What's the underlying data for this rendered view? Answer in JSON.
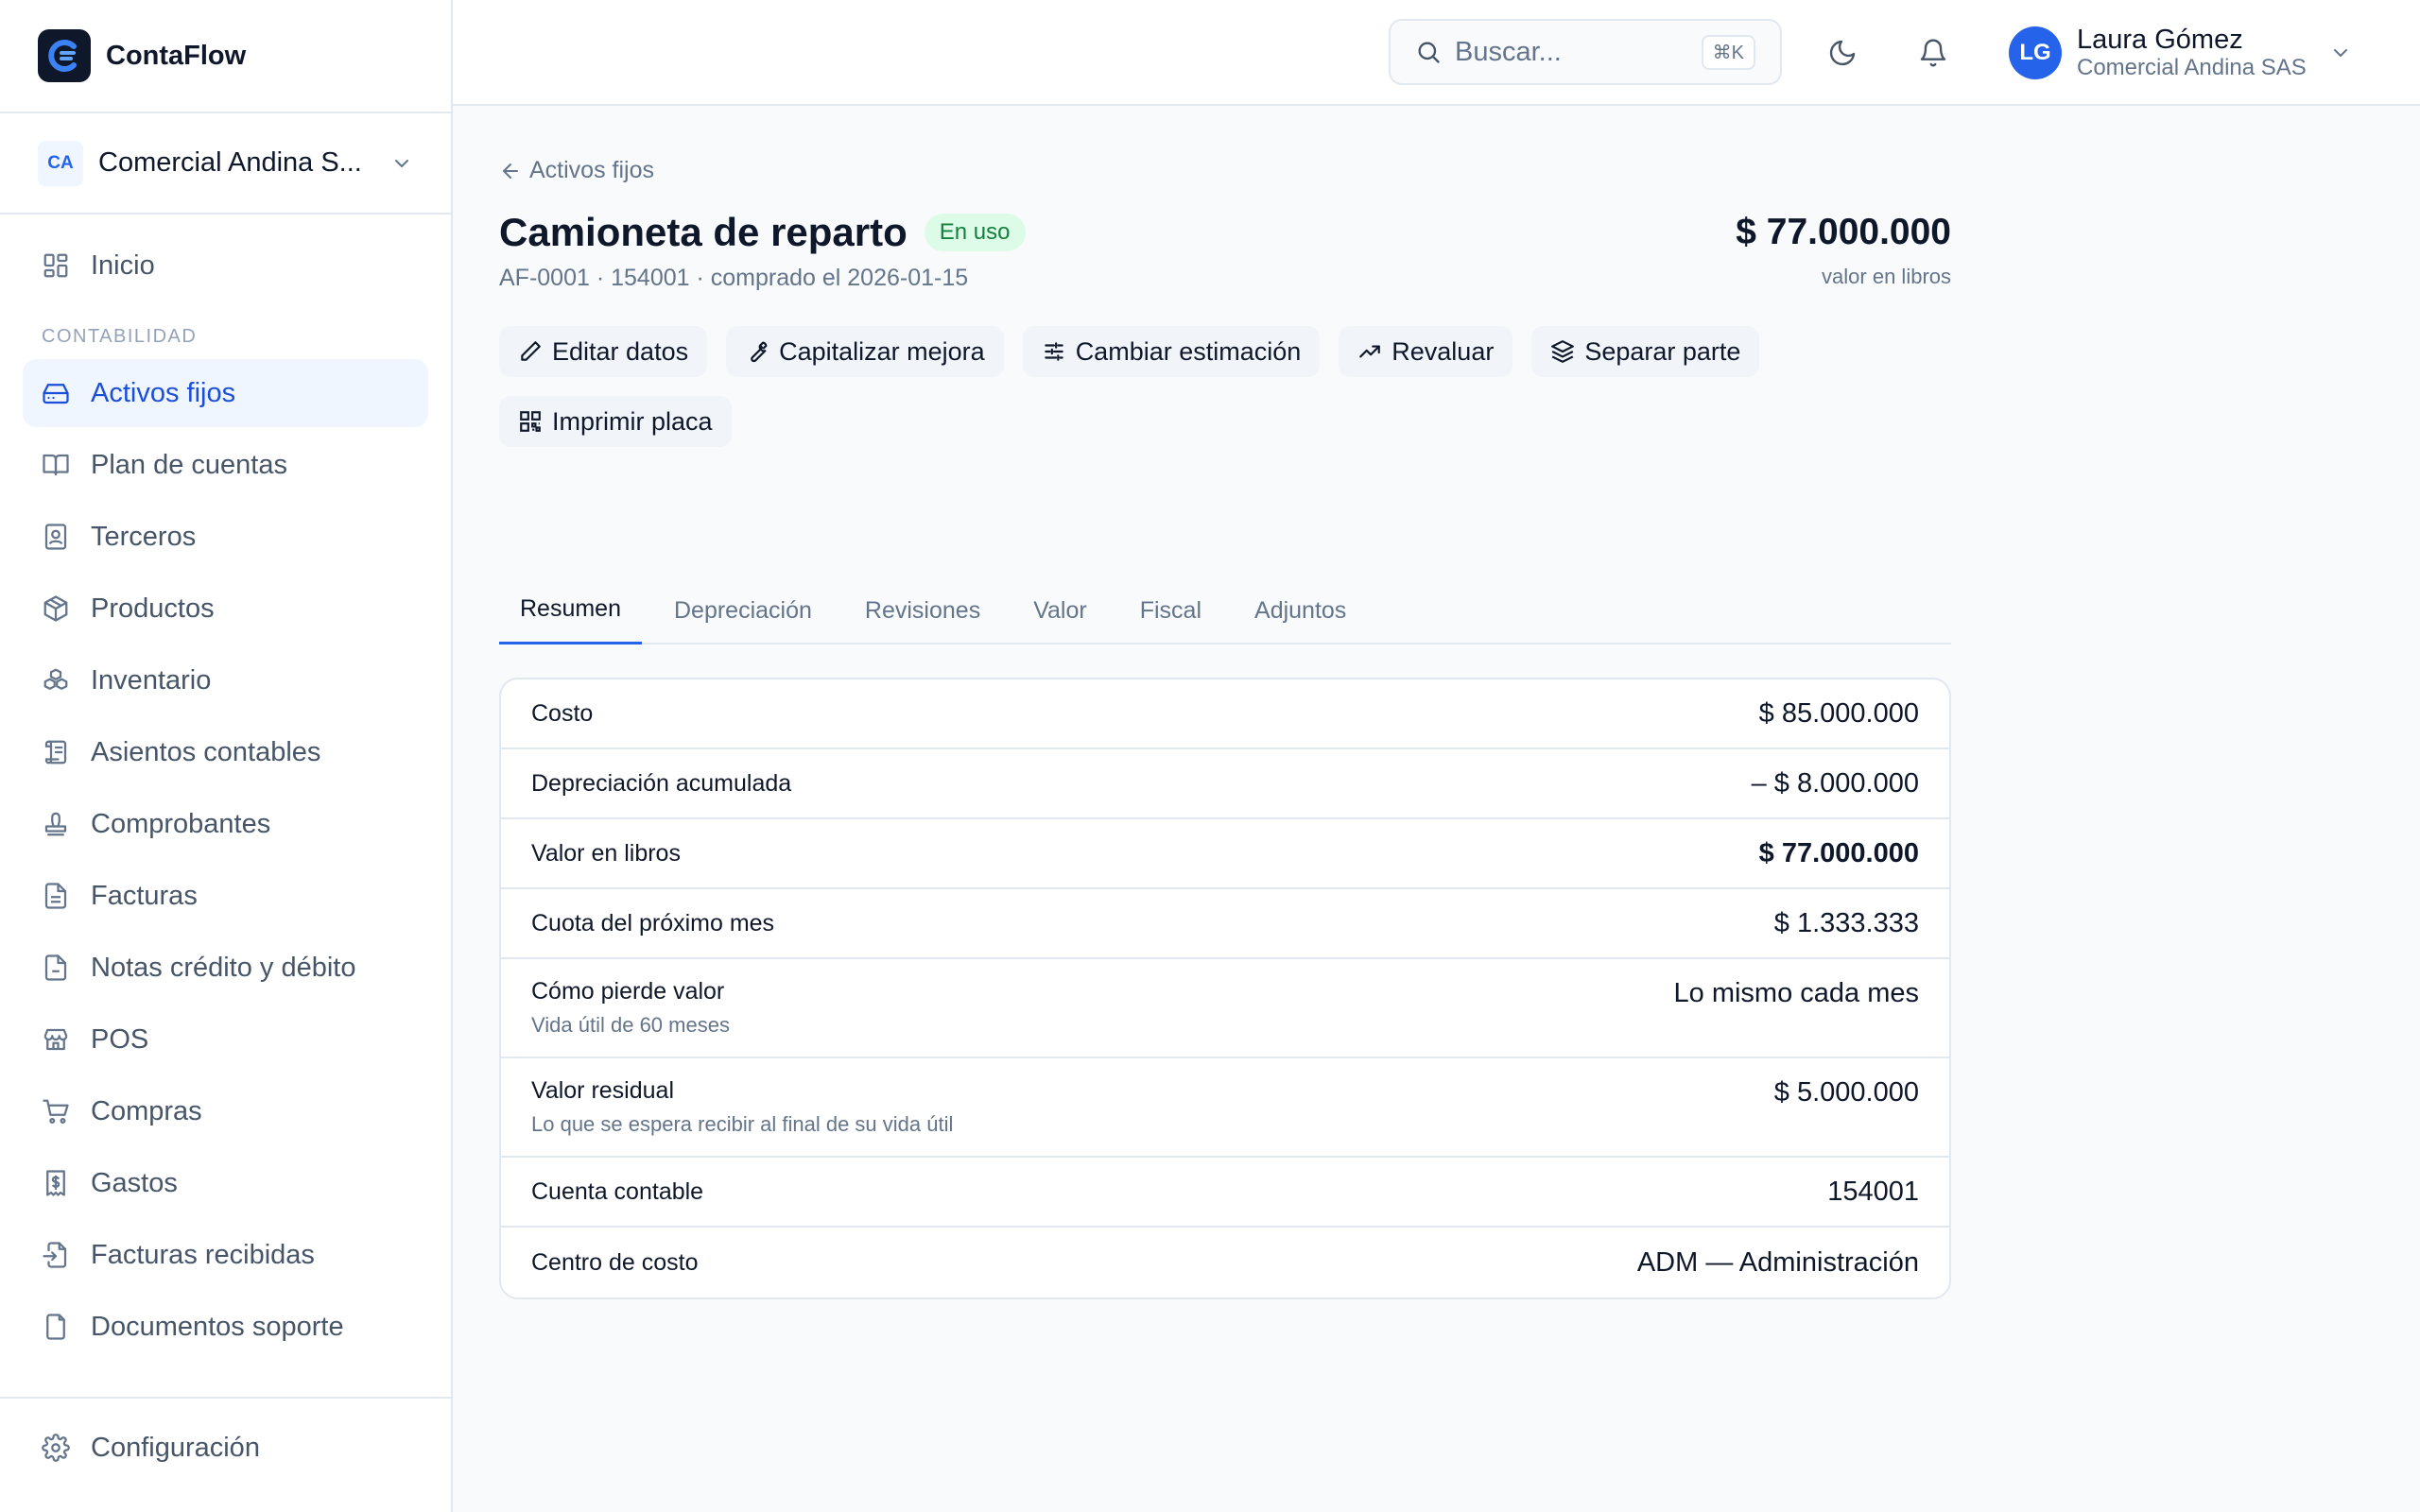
{
  "app": {
    "name": "ContaFlow"
  },
  "company": {
    "badge": "CA",
    "name": "Comercial Andina S..."
  },
  "sidebar": {
    "home": {
      "label": "Inicio",
      "icon": "grid-icon"
    },
    "section": "CONTABILIDAD",
    "items": [
      {
        "label": "Activos fijos",
        "icon": "hard-drive-icon",
        "active": true
      },
      {
        "label": "Plan de cuentas",
        "icon": "book-icon"
      },
      {
        "label": "Terceros",
        "icon": "contact-icon"
      },
      {
        "label": "Productos",
        "icon": "package-icon"
      },
      {
        "label": "Inventario",
        "icon": "boxes-icon"
      },
      {
        "label": "Asientos contables",
        "icon": "scroll-icon"
      },
      {
        "label": "Comprobantes",
        "icon": "stamp-icon"
      },
      {
        "label": "Facturas",
        "icon": "file-text-icon"
      },
      {
        "label": "Notas crédito y débito",
        "icon": "file-icon"
      },
      {
        "label": "POS",
        "icon": "store-icon"
      },
      {
        "label": "Compras",
        "icon": "cart-icon"
      },
      {
        "label": "Gastos",
        "icon": "receipt-icon"
      },
      {
        "label": "Facturas recibidas",
        "icon": "file-import-icon"
      },
      {
        "label": "Documentos soporte",
        "icon": "file-copy-icon"
      }
    ],
    "footer": {
      "label": "Configuración",
      "icon": "gear-icon"
    }
  },
  "topbar": {
    "search_placeholder": "Buscar...",
    "shortcut": "⌘K",
    "user": {
      "initials": "LG",
      "name": "Laura Gómez",
      "company": "Comercial Andina SAS"
    }
  },
  "asset": {
    "back_label": "Activos fijos",
    "title": "Camioneta de reparto",
    "status": "En uso",
    "subtitle": "AF-0001 · 154001 · comprado el 2026-01-15",
    "book_value": "$ 77.000.000",
    "book_value_label": "valor en libros"
  },
  "actions": [
    {
      "label": "Editar datos",
      "icon": "pencil-icon"
    },
    {
      "label": "Capitalizar mejora",
      "icon": "wrench-icon"
    },
    {
      "label": "Cambiar estimación",
      "icon": "sliders-icon"
    },
    {
      "label": "Revaluar",
      "icon": "trending-up-icon"
    },
    {
      "label": "Separar parte",
      "icon": "layers-icon"
    },
    {
      "label": "Imprimir placa",
      "icon": "qr-code-icon"
    }
  ],
  "tabs": [
    {
      "label": "Resumen",
      "active": true
    },
    {
      "label": "Depreciación"
    },
    {
      "label": "Revisiones"
    },
    {
      "label": "Valor"
    },
    {
      "label": "Fiscal"
    },
    {
      "label": "Adjuntos"
    }
  ],
  "summary": [
    {
      "label": "Costo",
      "value": "$ 85.000.000"
    },
    {
      "label": "Depreciación acumulada",
      "value": "– $ 8.000.000"
    },
    {
      "label": "Valor en libros",
      "value": "$ 77.000.000",
      "bold": true
    },
    {
      "label": "Cuota del próximo mes",
      "value": "$ 1.333.333"
    },
    {
      "label": "Cómo pierde valor",
      "sub": "Vida útil de 60 meses",
      "value": "Lo mismo cada mes"
    },
    {
      "label": "Valor residual",
      "sub": "Lo que se espera recibir al final de su vida útil",
      "value": "$ 5.000.000"
    },
    {
      "label": "Cuenta contable",
      "value": "154001"
    },
    {
      "label": "Centro de costo",
      "value": "ADM — Administración"
    }
  ],
  "colors": {
    "accent": "#2563eb",
    "active_bg": "#eff6ff",
    "status_bg": "#dcfce7",
    "status_text": "#15803d"
  }
}
